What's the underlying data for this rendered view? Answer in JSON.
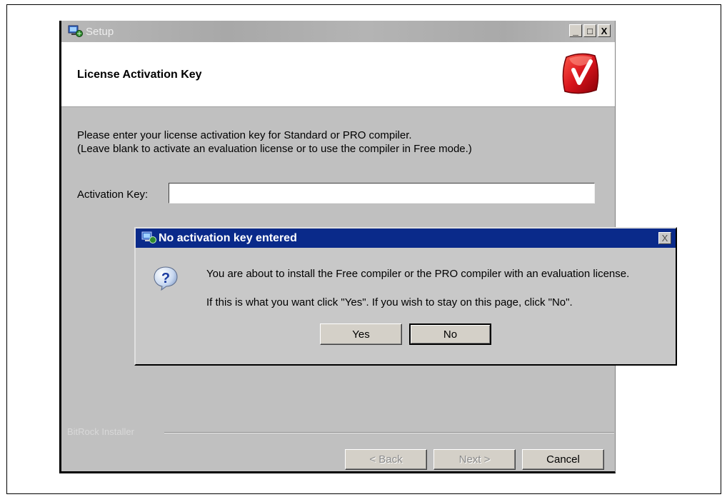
{
  "setup_window": {
    "title": "Setup",
    "controls": {
      "minimize": "_",
      "maximize": "□",
      "close": "X"
    },
    "header_title": "License Activation Key",
    "logo_icon": "mplab-logo-icon",
    "instruction_line1": "Please enter your license activation key for Standard or PRO compiler.",
    "instruction_line2": "(Leave blank to activate an evaluation license or to use the compiler in Free mode.)",
    "activation_key_label": "Activation Key:",
    "activation_key_value": "",
    "brand": "BitRock Installer",
    "buttons": {
      "back": "< Back",
      "next": "Next >",
      "cancel": "Cancel"
    }
  },
  "dialog": {
    "title": "No activation key entered",
    "close": "X",
    "icon": "question-icon",
    "message1": "You are about to install the Free compiler or the PRO compiler with an evaluation license.",
    "message2": "If this is what you want click \"Yes\". If you wish to stay on this page, click \"No\".",
    "buttons": {
      "yes": "Yes",
      "no": "No"
    }
  },
  "colors": {
    "dialog_titlebar": "#0a2a8a",
    "window_face": "#c0c0c0",
    "logo_red": "#d8141c"
  }
}
